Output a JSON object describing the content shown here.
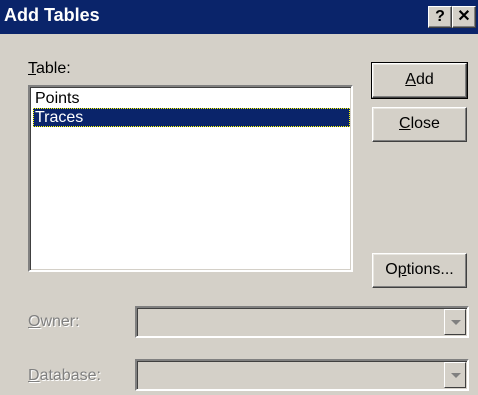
{
  "window": {
    "title": "Add Tables",
    "help_label": "?",
    "close_label": "✕"
  },
  "table_label": "Table:",
  "tables": [
    "Points",
    "Traces"
  ],
  "selected_table": "Traces",
  "buttons": {
    "add": "Add",
    "close": "Close",
    "options": "Options..."
  },
  "owner": {
    "label": "Owner:",
    "value": ""
  },
  "database": {
    "label": "Database:",
    "value": ""
  },
  "icons": {
    "dropdown": "chevron-down-icon",
    "help": "question-icon",
    "close": "close-icon"
  },
  "colors": {
    "titlebar": "#0a246a",
    "selection": "#0a246a",
    "face": "#d4d0c8"
  }
}
